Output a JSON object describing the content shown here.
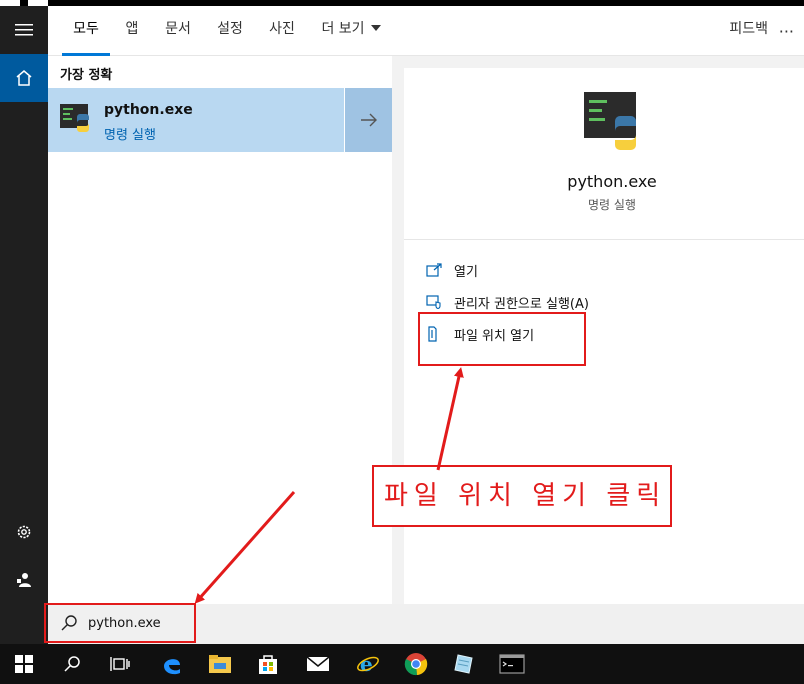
{
  "tabs": [
    {
      "label": "모두",
      "active": true
    },
    {
      "label": "앱"
    },
    {
      "label": "문서"
    },
    {
      "label": "설정"
    },
    {
      "label": "사진"
    },
    {
      "label": "더 보기"
    }
  ],
  "feedback_label": "피드백",
  "more_options": "···",
  "best_match": {
    "section_title": "가장 정확",
    "name": "python.exe",
    "subtitle": "명령 실행"
  },
  "detail": {
    "name": "python.exe",
    "subtitle": "명령 실행",
    "actions": [
      {
        "label": "열기"
      },
      {
        "label": "관리자 권한으로 실행(A)"
      },
      {
        "label": "파일 위치 열기"
      }
    ]
  },
  "search": {
    "value": "python.exe"
  },
  "annotation": {
    "callout": "파일 위치 열기 클릭"
  },
  "colors": {
    "accent": "#0078d7",
    "highlight": "#b9d8f1",
    "annotation_red": "#e21b1b"
  },
  "icons": {
    "rail": [
      "hamburger-icon",
      "home-icon",
      "settings-gear-icon",
      "user-icon"
    ],
    "taskbar": [
      "windows-start-icon",
      "search-icon",
      "task-view-icon",
      "edge-icon",
      "file-explorer-icon",
      "store-icon",
      "mail-icon",
      "internet-explorer-icon",
      "chrome-icon",
      "notepad-icon",
      "terminal-icon"
    ]
  }
}
